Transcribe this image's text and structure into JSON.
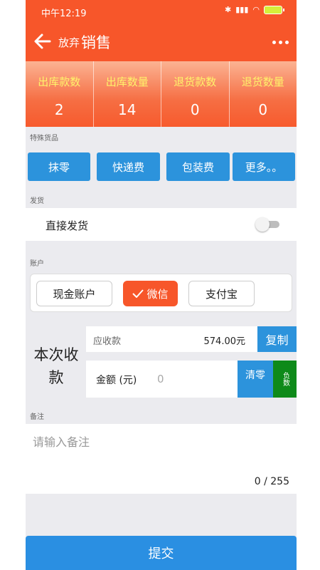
{
  "status_bar": {
    "time": "中午12:19"
  },
  "header": {
    "discard_label": "放弃",
    "title": "销售"
  },
  "stats": [
    {
      "label": "出库款数",
      "value": "2"
    },
    {
      "label": "出库数量",
      "value": "14"
    },
    {
      "label": "退货款数",
      "value": "0"
    },
    {
      "label": "退货数量",
      "value": "0"
    }
  ],
  "special_goods": {
    "section_label": "特殊货品",
    "buttons": [
      "抹零",
      "快递费",
      "包装费",
      "更多。。"
    ]
  },
  "shipping": {
    "section_label": "发货",
    "direct_ship_label": "直接发货",
    "direct_ship_enabled": false
  },
  "account": {
    "section_label": "账户",
    "options": [
      "现金账户",
      "微信",
      "支付宝"
    ],
    "selected": "微信"
  },
  "collection": {
    "label": "本次收款",
    "due_label": "应收款",
    "due_value": "574.00元",
    "copy_label": "复制",
    "amount_label": "金额 (元)",
    "amount_placeholder": "0",
    "clear_label": "清零",
    "negative_label": "负数"
  },
  "remark": {
    "section_label": "备注",
    "placeholder": "请输入备注",
    "count": "0 / 255"
  },
  "submit_label": "提交",
  "colors": {
    "primary": "#f7562a",
    "button_blue": "#2c93dc",
    "negative_green": "#0e8a1a"
  }
}
